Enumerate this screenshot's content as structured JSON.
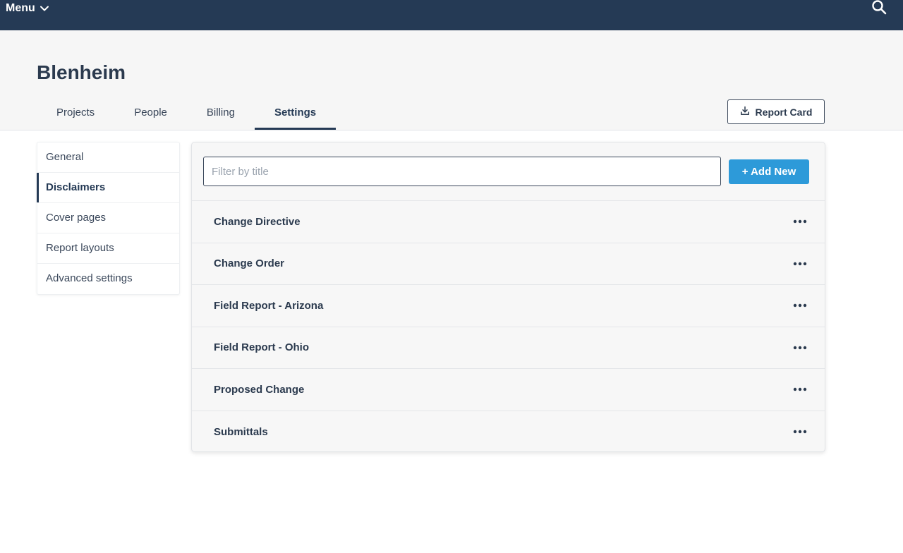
{
  "topbar": {
    "menu_label": "Menu"
  },
  "header": {
    "title": "Blenheim",
    "tabs": [
      {
        "label": "Projects"
      },
      {
        "label": "People"
      },
      {
        "label": "Billing"
      },
      {
        "label": "Settings",
        "active": true
      }
    ],
    "report_card_label": "Report Card"
  },
  "sidebar": {
    "items": [
      {
        "label": "General"
      },
      {
        "label": "Disclaimers",
        "active": true
      },
      {
        "label": "Cover pages"
      },
      {
        "label": "Report layouts"
      },
      {
        "label": "Advanced settings"
      }
    ]
  },
  "main": {
    "filter_placeholder": "Filter by title",
    "filter_value": "",
    "add_button_label": "+ Add New",
    "rows": [
      {
        "title": "Change Directive"
      },
      {
        "title": "Change Order"
      },
      {
        "title": "Field Report - Arizona"
      },
      {
        "title": "Field Report - Ohio"
      },
      {
        "title": "Proposed Change"
      },
      {
        "title": "Submittals"
      }
    ]
  },
  "colors": {
    "topbar": "#253a55",
    "accent": "#2d9ad9",
    "text": "#2b3a4e"
  },
  "icons": {
    "menu": "chevron-down-icon",
    "search": "search-icon",
    "report_card": "download-icon",
    "row_actions": "more-horizontal-icon"
  }
}
